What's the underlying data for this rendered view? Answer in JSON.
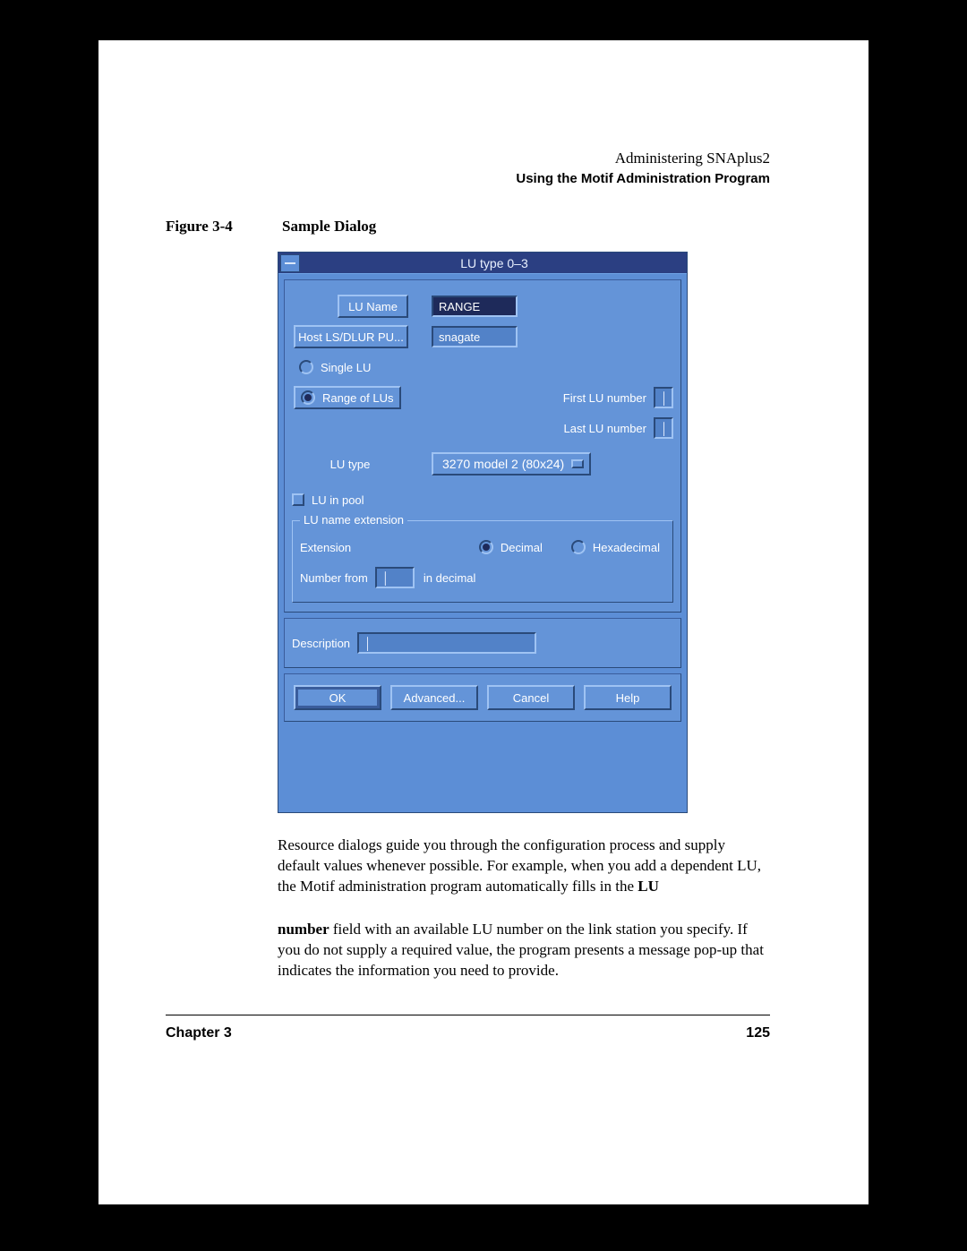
{
  "header": {
    "title": "Administering SNAplus2",
    "subtitle": "Using the Motif Administration Program"
  },
  "figure": {
    "label": "Figure 3-4",
    "caption": "Sample Dialog"
  },
  "dialog": {
    "title": "LU type 0–3",
    "lu_name_label": "LU Name",
    "lu_name_value": "RANGE",
    "host_label": "Host LS/DLUR PU...",
    "host_value": "snagate",
    "single_lu": "Single LU",
    "range_of_lus": "Range of LUs",
    "first_lu": "First LU number",
    "last_lu": "Last LU number",
    "lu_type_label": "LU type",
    "lu_type_value": "3270 model 2 (80x24)",
    "lu_in_pool": "LU in pool",
    "ext_group": "LU name extension",
    "extension_label": "Extension",
    "decimal": "Decimal",
    "hex": "Hexadecimal",
    "number_from": "Number from",
    "in_decimal": "in decimal",
    "description_label": "Description",
    "buttons": {
      "ok": "OK",
      "advanced": "Advanced...",
      "cancel": "Cancel",
      "help": "Help"
    }
  },
  "body_text": {
    "p1": "Resource dialogs guide you through the configuration process and supply default values whenever possible. For example, when you add a dependent LU, the Motif administration program automatically fills in the ",
    "p1b": "LU",
    "p2a": "number",
    "p2b": " field with an available LU number on the link station you specify. If you do not supply a required value, the program presents a message pop-up that indicates the information you need to provide."
  },
  "footer": {
    "left": "Chapter 3",
    "right": "125"
  }
}
